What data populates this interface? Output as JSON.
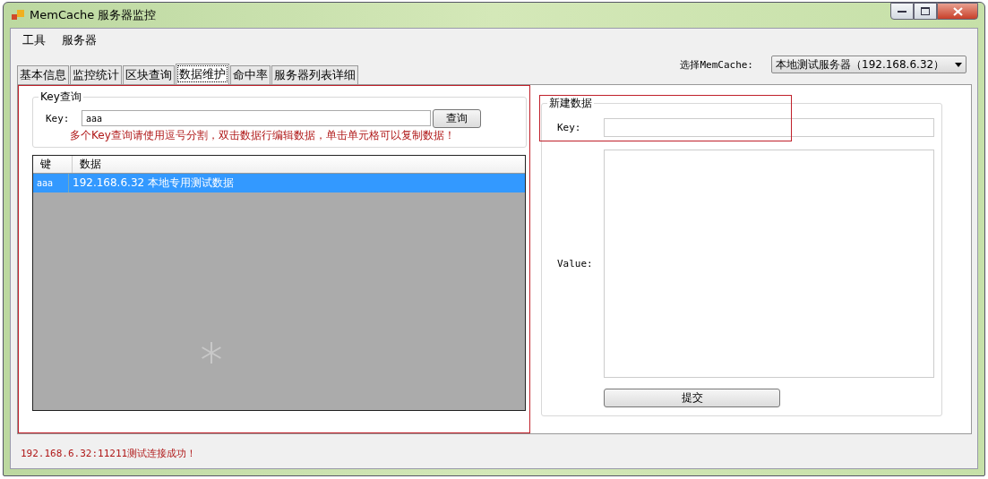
{
  "window": {
    "title": "MemCache 服务器监控"
  },
  "menu": [
    "工具",
    "服务器"
  ],
  "tabs": [
    {
      "label": "基本信息",
      "selected": false
    },
    {
      "label": "监控统计",
      "selected": false
    },
    {
      "label": "区块查询",
      "selected": false
    },
    {
      "label": "数据维护",
      "selected": true
    },
    {
      "label": "命中率",
      "selected": false
    },
    {
      "label": "服务器列表详细",
      "selected": false
    }
  ],
  "server_select": {
    "label": "选择MemCache:",
    "value": "本地测试服务器（192.168.6.32）"
  },
  "key_query": {
    "title": "Key查询",
    "key_label": "Key:",
    "key_value": "aaa",
    "button": "查询",
    "hint": "多个Key查询请使用逗号分割，双击数据行编辑数据，单击单元格可以复制数据！"
  },
  "grid": {
    "columns": [
      "键",
      "数据"
    ],
    "rows": [
      {
        "cells": [
          "aaa",
          "192.168.6.32 本地专用测试数据"
        ],
        "selected": true
      }
    ]
  },
  "new_data": {
    "title": "新建数据",
    "key_label": "Key:",
    "value_label": "Value:",
    "button": "提交"
  },
  "status": "192.168.6.32:11211测试连接成功！"
}
